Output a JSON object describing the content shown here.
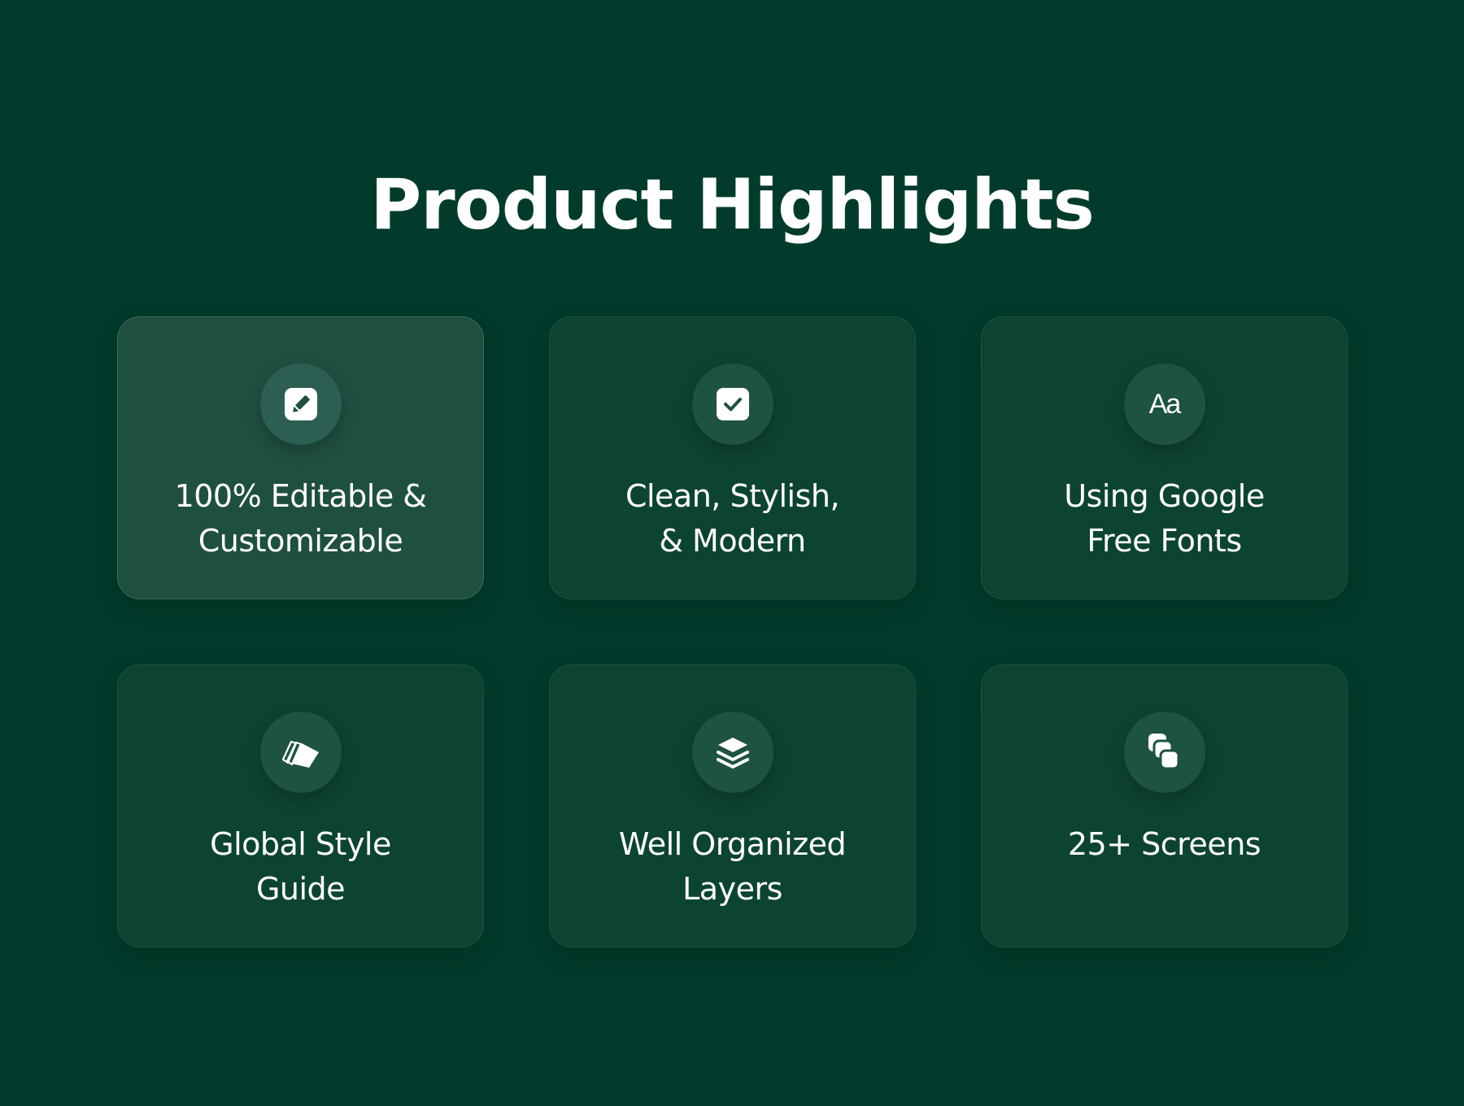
{
  "page": {
    "title": "Product Highlights"
  },
  "colors": {
    "background": "#023b2b",
    "card": "#0d4332",
    "card_active": "#1f4f41",
    "icon_circle": "#1e5243",
    "text": "#ffffff"
  },
  "highlights": [
    {
      "icon": "edit-icon",
      "line1": "100% Editable &",
      "line2": "Customizable",
      "active": true
    },
    {
      "icon": "checkbox-icon",
      "line1": "Clean, Stylish,",
      "line2": "& Modern",
      "active": false
    },
    {
      "icon": "font-icon",
      "icon_text": "Aa",
      "line1": "Using Google",
      "line2": "Free Fonts",
      "active": false
    },
    {
      "icon": "swatches-icon",
      "line1": "Global Style",
      "line2": "Guide",
      "active": false
    },
    {
      "icon": "layers-icon",
      "line1": "Well Organized",
      "line2": "Layers",
      "active": false
    },
    {
      "icon": "screens-icon",
      "line1": "25+ Screens",
      "line2": "",
      "active": false
    }
  ]
}
